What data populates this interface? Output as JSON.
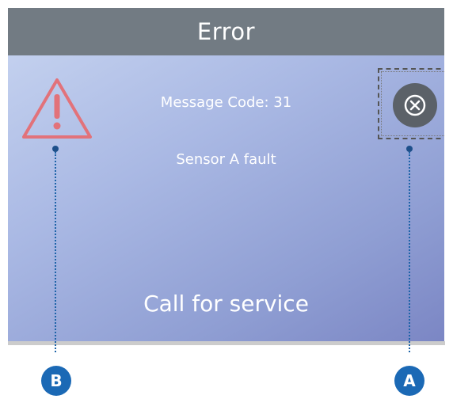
{
  "header": {
    "title": "Error"
  },
  "message": {
    "code_text": "Message Code: 31",
    "fault_text": "Sensor A fault",
    "action_text": "Call for service"
  },
  "icons": {
    "warning": "warning-triangle-icon",
    "close": "close-circle-x-icon"
  },
  "callouts": {
    "left_label": "B",
    "right_label": "A"
  },
  "colors": {
    "titlebar": "#727b83",
    "warning": "#e2727a",
    "close_button": "#5b6168",
    "callout": "#1b69b5"
  }
}
